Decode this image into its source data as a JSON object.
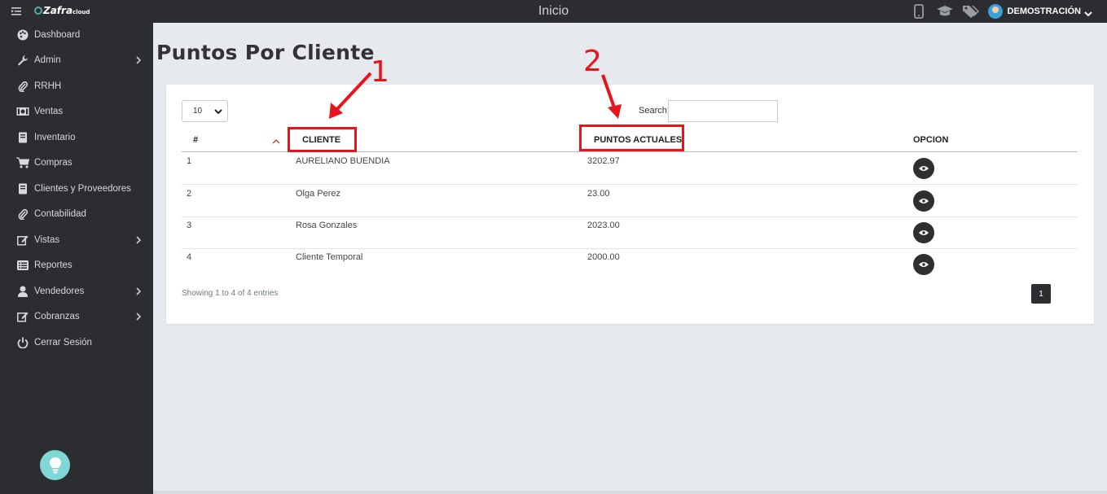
{
  "topbar": {
    "app_logo": "Zafra",
    "app_logo_suffix": "cloud",
    "title": "Inicio",
    "icons": [
      "mobile-icon",
      "graduation-cap-icon",
      "tags-icon"
    ],
    "user_name": "DEMOSTRACIÓN"
  },
  "sidebar": {
    "items": [
      {
        "label": "Dashboard",
        "icon": "palette-icon",
        "has_submenu": false
      },
      {
        "label": "Admin",
        "icon": "wrench-icon",
        "has_submenu": true
      },
      {
        "label": "RRHH",
        "icon": "paperclip-icon",
        "has_submenu": false
      },
      {
        "label": "Ventas",
        "icon": "money-icon",
        "has_submenu": false
      },
      {
        "label": "Inventario",
        "icon": "book-icon",
        "has_submenu": false
      },
      {
        "label": "Compras",
        "icon": "cart-icon",
        "has_submenu": false
      },
      {
        "label": "Clientes y Proveedores",
        "icon": "book-icon",
        "has_submenu": false
      },
      {
        "label": "Contabilidad",
        "icon": "paperclip-icon",
        "has_submenu": false
      },
      {
        "label": "Vistas",
        "icon": "edit-icon",
        "has_submenu": true
      },
      {
        "label": "Reportes",
        "icon": "list-icon",
        "has_submenu": false
      },
      {
        "label": "Vendedores",
        "icon": "user-icon",
        "has_submenu": true
      },
      {
        "label": "Cobranzas",
        "icon": "edit-icon",
        "has_submenu": true
      },
      {
        "label": "Cerrar Sesión",
        "icon": "power-icon",
        "has_submenu": false
      }
    ]
  },
  "page": {
    "title": "Puntos Por Cliente"
  },
  "table": {
    "length_value": "10",
    "search_label": "Search:",
    "search_value": "",
    "columns": [
      "#",
      "CLIENTE",
      "PUNTOS ACTUALES",
      "OPCION"
    ],
    "rows": [
      {
        "num": "1",
        "cliente": "AURELIANO BUENDIA",
        "puntos": "3202.97"
      },
      {
        "num": "2",
        "cliente": "Olga Perez",
        "puntos": "23.00"
      },
      {
        "num": "3",
        "cliente": "Rosa Gonzales",
        "puntos": "2023.00"
      },
      {
        "num": "4",
        "cliente": "Cliente Temporal",
        "puntos": "2000.00"
      }
    ],
    "info": "Showing 1 to 4 of 4 entries",
    "current_page": "1"
  },
  "annotations": {
    "labels": [
      "1",
      "2"
    ],
    "color": "#e8141c"
  }
}
